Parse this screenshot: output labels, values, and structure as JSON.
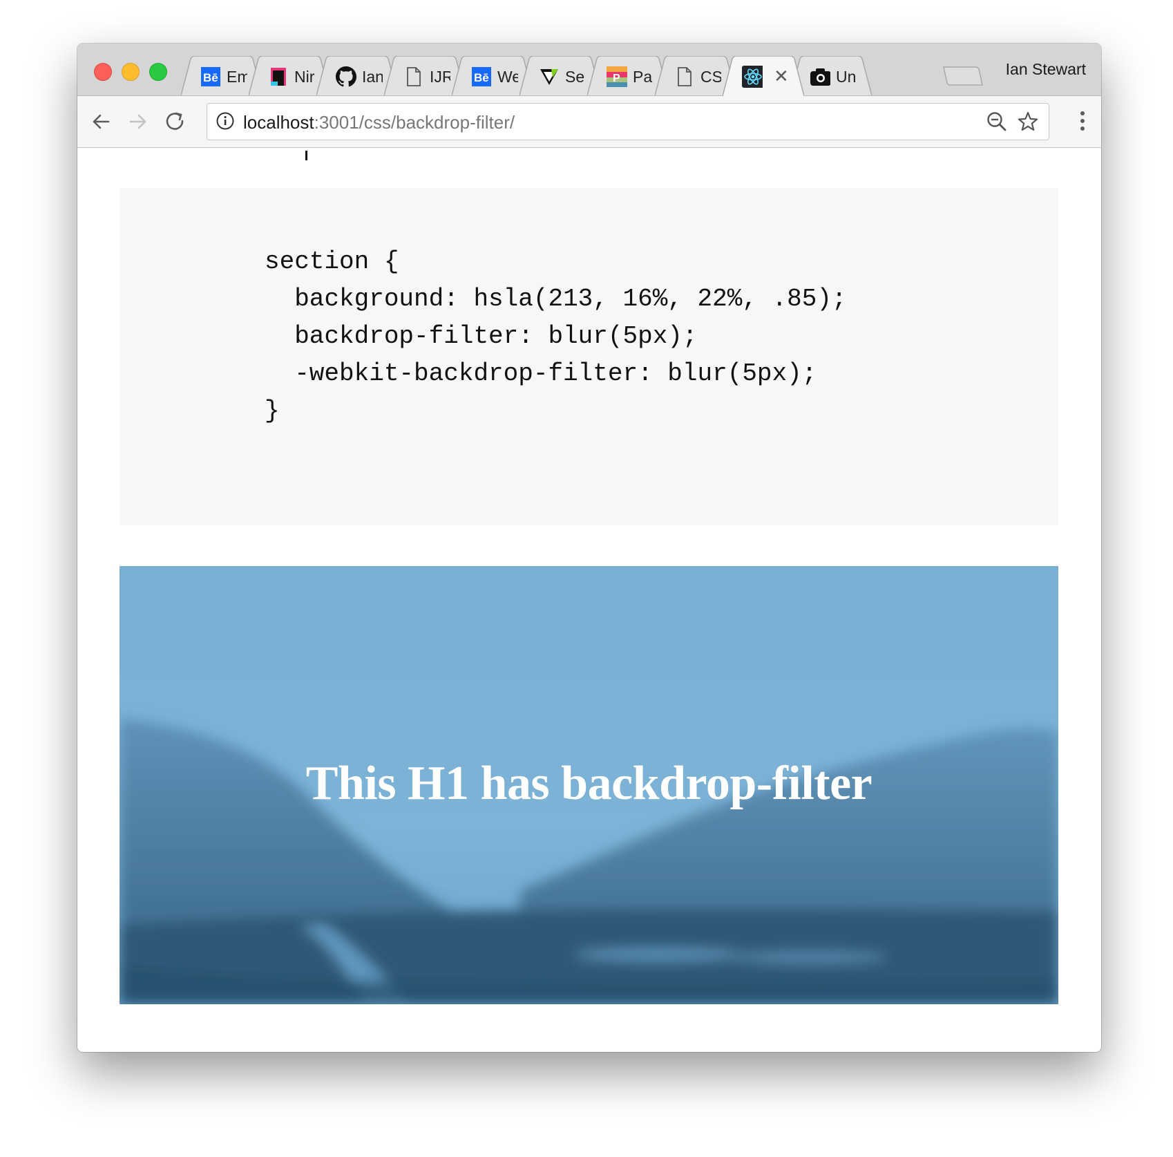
{
  "browser": {
    "profile_name": "Ian Stewart",
    "tabs": [
      {
        "label": "Em",
        "icon": "behance-icon"
      },
      {
        "label": "Nir",
        "icon": "nirvana-app-icon"
      },
      {
        "label": "Ian",
        "icon": "github-icon"
      },
      {
        "label": "IJR",
        "icon": "document-icon"
      },
      {
        "label": "We",
        "icon": "behance-icon"
      },
      {
        "label": "Se",
        "icon": "vuetify-icon"
      },
      {
        "label": "Pa",
        "icon": "palette-icon"
      },
      {
        "label": "CS",
        "icon": "document-icon"
      },
      {
        "label": "",
        "icon": "react-icon",
        "active": true
      },
      {
        "label": "Un",
        "icon": "camera-icon"
      }
    ],
    "url_host": "localhost",
    "url_path": ":3001/css/backdrop-filter/"
  },
  "page": {
    "code_lines": [
      "section {",
      "  background: hsla(213, 16%, 22%, .85);",
      "  backdrop-filter: blur(5px);",
      "  -webkit-backdrop-filter: blur(5px);",
      "}"
    ],
    "hero_heading": "This H1 has backdrop-filter"
  },
  "colors": {
    "tabstrip": "#d5d5d5",
    "toolbar": "#f6f6f6",
    "code_background": "#f6f7f9",
    "hero_sky": "#7cb1d4",
    "hero_mountains": "#3f6f92"
  }
}
